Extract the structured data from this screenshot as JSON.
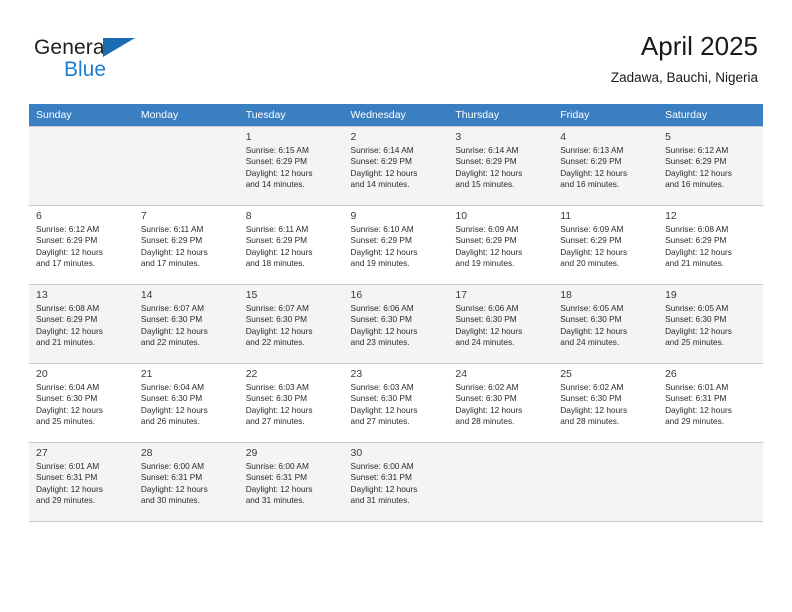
{
  "brand": {
    "name_part1": "General",
    "name_part2": "Blue",
    "triangle_color": "#1b6cb3",
    "blue_color": "#1b7fd4"
  },
  "header": {
    "title": "April 2025",
    "subtitle": "Zadawa, Bauchi, Nigeria"
  },
  "calendar": {
    "header_bg": "#3a7fc1",
    "weekdays": [
      "Sunday",
      "Monday",
      "Tuesday",
      "Wednesday",
      "Thursday",
      "Friday",
      "Saturday"
    ],
    "weeks": [
      [
        {
          "day": "",
          "sunrise": "",
          "sunset": "",
          "daylight_line1": "",
          "daylight_line2": ""
        },
        {
          "day": "",
          "sunrise": "",
          "sunset": "",
          "daylight_line1": "",
          "daylight_line2": ""
        },
        {
          "day": "1",
          "sunrise": "Sunrise: 6:15 AM",
          "sunset": "Sunset: 6:29 PM",
          "daylight_line1": "Daylight: 12 hours",
          "daylight_line2": "and 14 minutes."
        },
        {
          "day": "2",
          "sunrise": "Sunrise: 6:14 AM",
          "sunset": "Sunset: 6:29 PM",
          "daylight_line1": "Daylight: 12 hours",
          "daylight_line2": "and 14 minutes."
        },
        {
          "day": "3",
          "sunrise": "Sunrise: 6:14 AM",
          "sunset": "Sunset: 6:29 PM",
          "daylight_line1": "Daylight: 12 hours",
          "daylight_line2": "and 15 minutes."
        },
        {
          "day": "4",
          "sunrise": "Sunrise: 6:13 AM",
          "sunset": "Sunset: 6:29 PM",
          "daylight_line1": "Daylight: 12 hours",
          "daylight_line2": "and 16 minutes."
        },
        {
          "day": "5",
          "sunrise": "Sunrise: 6:12 AM",
          "sunset": "Sunset: 6:29 PM",
          "daylight_line1": "Daylight: 12 hours",
          "daylight_line2": "and 16 minutes."
        }
      ],
      [
        {
          "day": "6",
          "sunrise": "Sunrise: 6:12 AM",
          "sunset": "Sunset: 6:29 PM",
          "daylight_line1": "Daylight: 12 hours",
          "daylight_line2": "and 17 minutes."
        },
        {
          "day": "7",
          "sunrise": "Sunrise: 6:11 AM",
          "sunset": "Sunset: 6:29 PM",
          "daylight_line1": "Daylight: 12 hours",
          "daylight_line2": "and 17 minutes."
        },
        {
          "day": "8",
          "sunrise": "Sunrise: 6:11 AM",
          "sunset": "Sunset: 6:29 PM",
          "daylight_line1": "Daylight: 12 hours",
          "daylight_line2": "and 18 minutes."
        },
        {
          "day": "9",
          "sunrise": "Sunrise: 6:10 AM",
          "sunset": "Sunset: 6:29 PM",
          "daylight_line1": "Daylight: 12 hours",
          "daylight_line2": "and 19 minutes."
        },
        {
          "day": "10",
          "sunrise": "Sunrise: 6:09 AM",
          "sunset": "Sunset: 6:29 PM",
          "daylight_line1": "Daylight: 12 hours",
          "daylight_line2": "and 19 minutes."
        },
        {
          "day": "11",
          "sunrise": "Sunrise: 6:09 AM",
          "sunset": "Sunset: 6:29 PM",
          "daylight_line1": "Daylight: 12 hours",
          "daylight_line2": "and 20 minutes."
        },
        {
          "day": "12",
          "sunrise": "Sunrise: 6:08 AM",
          "sunset": "Sunset: 6:29 PM",
          "daylight_line1": "Daylight: 12 hours",
          "daylight_line2": "and 21 minutes."
        }
      ],
      [
        {
          "day": "13",
          "sunrise": "Sunrise: 6:08 AM",
          "sunset": "Sunset: 6:29 PM",
          "daylight_line1": "Daylight: 12 hours",
          "daylight_line2": "and 21 minutes."
        },
        {
          "day": "14",
          "sunrise": "Sunrise: 6:07 AM",
          "sunset": "Sunset: 6:30 PM",
          "daylight_line1": "Daylight: 12 hours",
          "daylight_line2": "and 22 minutes."
        },
        {
          "day": "15",
          "sunrise": "Sunrise: 6:07 AM",
          "sunset": "Sunset: 6:30 PM",
          "daylight_line1": "Daylight: 12 hours",
          "daylight_line2": "and 22 minutes."
        },
        {
          "day": "16",
          "sunrise": "Sunrise: 6:06 AM",
          "sunset": "Sunset: 6:30 PM",
          "daylight_line1": "Daylight: 12 hours",
          "daylight_line2": "and 23 minutes."
        },
        {
          "day": "17",
          "sunrise": "Sunrise: 6:06 AM",
          "sunset": "Sunset: 6:30 PM",
          "daylight_line1": "Daylight: 12 hours",
          "daylight_line2": "and 24 minutes."
        },
        {
          "day": "18",
          "sunrise": "Sunrise: 6:05 AM",
          "sunset": "Sunset: 6:30 PM",
          "daylight_line1": "Daylight: 12 hours",
          "daylight_line2": "and 24 minutes."
        },
        {
          "day": "19",
          "sunrise": "Sunrise: 6:05 AM",
          "sunset": "Sunset: 6:30 PM",
          "daylight_line1": "Daylight: 12 hours",
          "daylight_line2": "and 25 minutes."
        }
      ],
      [
        {
          "day": "20",
          "sunrise": "Sunrise: 6:04 AM",
          "sunset": "Sunset: 6:30 PM",
          "daylight_line1": "Daylight: 12 hours",
          "daylight_line2": "and 25 minutes."
        },
        {
          "day": "21",
          "sunrise": "Sunrise: 6:04 AM",
          "sunset": "Sunset: 6:30 PM",
          "daylight_line1": "Daylight: 12 hours",
          "daylight_line2": "and 26 minutes."
        },
        {
          "day": "22",
          "sunrise": "Sunrise: 6:03 AM",
          "sunset": "Sunset: 6:30 PM",
          "daylight_line1": "Daylight: 12 hours",
          "daylight_line2": "and 27 minutes."
        },
        {
          "day": "23",
          "sunrise": "Sunrise: 6:03 AM",
          "sunset": "Sunset: 6:30 PM",
          "daylight_line1": "Daylight: 12 hours",
          "daylight_line2": "and 27 minutes."
        },
        {
          "day": "24",
          "sunrise": "Sunrise: 6:02 AM",
          "sunset": "Sunset: 6:30 PM",
          "daylight_line1": "Daylight: 12 hours",
          "daylight_line2": "and 28 minutes."
        },
        {
          "day": "25",
          "sunrise": "Sunrise: 6:02 AM",
          "sunset": "Sunset: 6:30 PM",
          "daylight_line1": "Daylight: 12 hours",
          "daylight_line2": "and 28 minutes."
        },
        {
          "day": "26",
          "sunrise": "Sunrise: 6:01 AM",
          "sunset": "Sunset: 6:31 PM",
          "daylight_line1": "Daylight: 12 hours",
          "daylight_line2": "and 29 minutes."
        }
      ],
      [
        {
          "day": "27",
          "sunrise": "Sunrise: 6:01 AM",
          "sunset": "Sunset: 6:31 PM",
          "daylight_line1": "Daylight: 12 hours",
          "daylight_line2": "and 29 minutes."
        },
        {
          "day": "28",
          "sunrise": "Sunrise: 6:00 AM",
          "sunset": "Sunset: 6:31 PM",
          "daylight_line1": "Daylight: 12 hours",
          "daylight_line2": "and 30 minutes."
        },
        {
          "day": "29",
          "sunrise": "Sunrise: 6:00 AM",
          "sunset": "Sunset: 6:31 PM",
          "daylight_line1": "Daylight: 12 hours",
          "daylight_line2": "and 31 minutes."
        },
        {
          "day": "30",
          "sunrise": "Sunrise: 6:00 AM",
          "sunset": "Sunset: 6:31 PM",
          "daylight_line1": "Daylight: 12 hours",
          "daylight_line2": "and 31 minutes."
        },
        {
          "day": "",
          "sunrise": "",
          "sunset": "",
          "daylight_line1": "",
          "daylight_line2": ""
        },
        {
          "day": "",
          "sunrise": "",
          "sunset": "",
          "daylight_line1": "",
          "daylight_line2": ""
        },
        {
          "day": "",
          "sunrise": "",
          "sunset": "",
          "daylight_line1": "",
          "daylight_line2": ""
        }
      ]
    ]
  }
}
